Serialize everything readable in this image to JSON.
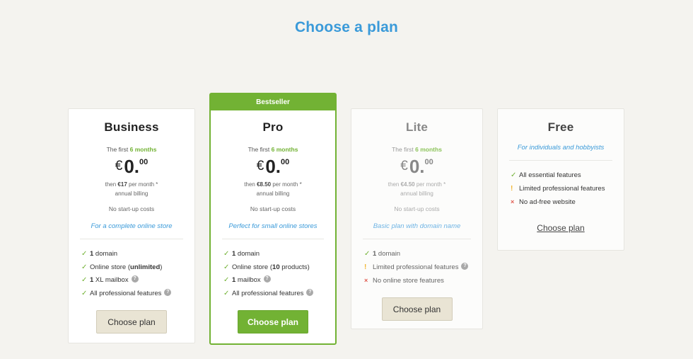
{
  "page_title": "Choose a plan",
  "colors": {
    "accent": "#3a9ad9",
    "brand_green": "#72b234",
    "warn": "#f2b632",
    "no": "#e05a4f"
  },
  "plans": [
    {
      "name": "Business",
      "promo_prefix": "The first",
      "promo_period": "6 months",
      "currency": "€",
      "price_int": "0.",
      "price_dec": "00",
      "then_prefix": "then",
      "then_price": "€17",
      "then_suffix": "per month *",
      "billing": "annual billing",
      "startup": "No start-up costs",
      "tagline": "For a complete online store",
      "features": [
        {
          "icon": "check-icon",
          "pre": "",
          "strong": "1",
          "post": " domain"
        },
        {
          "icon": "check-icon",
          "pre": "Online store (",
          "strong": "unlimited",
          "post": ")"
        },
        {
          "icon": "check-icon",
          "pre": "",
          "strong": "1",
          "post": " XL mailbox",
          "help": true
        },
        {
          "icon": "check-icon",
          "pre": "All professional features",
          "strong": "",
          "post": "",
          "help": true
        }
      ],
      "button": "Choose plan"
    },
    {
      "badge": "Bestseller",
      "name": "Pro",
      "promo_prefix": "The first",
      "promo_period": "6 months",
      "currency": "€",
      "price_int": "0.",
      "price_dec": "00",
      "then_prefix": "then",
      "then_price": "€8.50",
      "then_suffix": "per month *",
      "billing": "annual billing",
      "startup": "No start-up costs",
      "tagline": "Perfect for small online stores",
      "features": [
        {
          "icon": "check-icon",
          "pre": "",
          "strong": "1",
          "post": " domain"
        },
        {
          "icon": "check-icon",
          "pre": "Online store (",
          "strong": "10",
          "post": " products)"
        },
        {
          "icon": "check-icon",
          "pre": "",
          "strong": "1",
          "post": " mailbox",
          "help": true
        },
        {
          "icon": "check-icon",
          "pre": "All professional features",
          "strong": "",
          "post": "",
          "help": true
        }
      ],
      "button": "Choose plan"
    },
    {
      "name": "Lite",
      "promo_prefix": "The first",
      "promo_period": "6 months",
      "currency": "€",
      "price_int": "0.",
      "price_dec": "00",
      "then_prefix": "then",
      "then_price": "€4.50",
      "then_suffix": "per month *",
      "billing": "annual billing",
      "startup": "No start-up costs",
      "tagline": "Basic plan with domain name",
      "features": [
        {
          "icon": "check-icon",
          "pre": "",
          "strong": "1",
          "post": " domain"
        },
        {
          "icon": "warning-icon",
          "pre": "Limited professional features",
          "strong": "",
          "post": "",
          "help": true
        },
        {
          "icon": "cross-icon",
          "pre": "No online store features",
          "strong": "",
          "post": ""
        }
      ],
      "button": "Choose plan"
    },
    {
      "name": "Free",
      "tagline": "For individuals and hobbyists",
      "features": [
        {
          "icon": "check-icon",
          "pre": "All essential features",
          "strong": "",
          "post": ""
        },
        {
          "icon": "warning-icon",
          "pre": "Limited professional features",
          "strong": "",
          "post": ""
        },
        {
          "icon": "cross-icon",
          "pre": "No ad-free website",
          "strong": "",
          "post": ""
        }
      ],
      "button": "Choose plan"
    }
  ],
  "help_glyph": "?",
  "icon_glyphs": {
    "check-icon": "✓",
    "warning-icon": "!",
    "cross-icon": "×"
  }
}
